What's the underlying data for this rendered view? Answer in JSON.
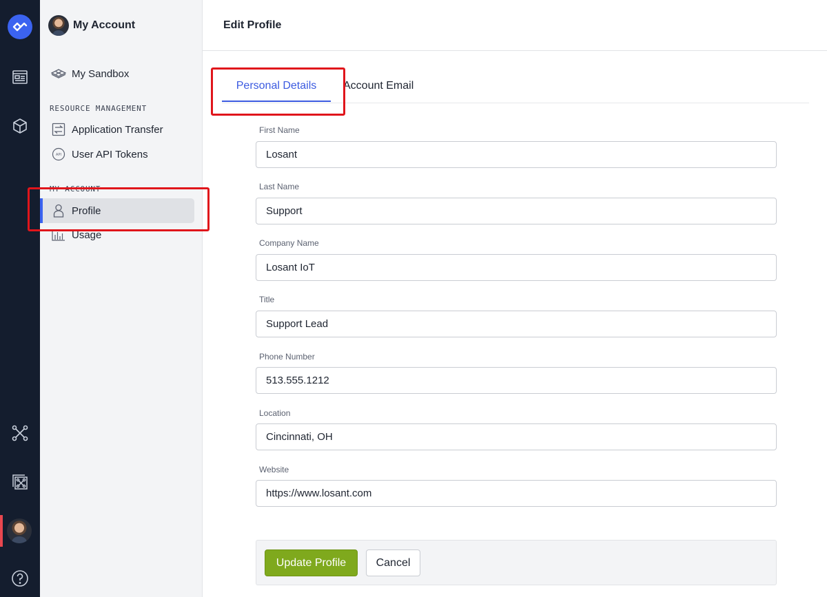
{
  "rail": {
    "items": [
      {
        "name": "logo",
        "icon": "losant-logo-icon"
      },
      {
        "name": "dashboards",
        "icon": "dashboard-icon"
      },
      {
        "name": "applications",
        "icon": "cube-icon"
      },
      {
        "name": "edge",
        "icon": "network-icon"
      },
      {
        "name": "experience",
        "icon": "nodes-grid-icon"
      },
      {
        "name": "account",
        "icon": "avatar"
      },
      {
        "name": "help",
        "icon": "help-icon"
      }
    ]
  },
  "sidebar": {
    "title": "My Account",
    "sandbox_label": "My Sandbox",
    "resource_section": "RESOURCE MANAGEMENT",
    "resource_items": [
      {
        "label": "Application Transfer",
        "icon": "transfer-icon"
      },
      {
        "label": "User API Tokens",
        "icon": "api-token-icon"
      }
    ],
    "account_section": "MY ACCOUNT",
    "account_items": [
      {
        "label": "Profile",
        "icon": "user-icon",
        "active": true
      },
      {
        "label": "Usage",
        "icon": "bar-chart-icon",
        "active": false
      }
    ]
  },
  "header": {
    "title": "Edit Profile"
  },
  "tabs": [
    {
      "label": "Personal Details",
      "active": true
    },
    {
      "label": "Account Email",
      "active": false
    }
  ],
  "form": {
    "fields": [
      {
        "label": "First Name",
        "value": "Losant"
      },
      {
        "label": "Last Name",
        "value": "Support"
      },
      {
        "label": "Company Name",
        "value": "Losant IoT"
      },
      {
        "label": "Title",
        "value": "Support Lead"
      },
      {
        "label": "Phone Number",
        "value": "513.555.1212"
      },
      {
        "label": "Location",
        "value": "Cincinnati, OH"
      },
      {
        "label": "Website",
        "value": "https://www.losant.com"
      }
    ],
    "submit_label": "Update Profile",
    "cancel_label": "Cancel"
  },
  "colors": {
    "accent": "#3b63f0",
    "primary_button": "#7fa91d",
    "highlight": "#e0151b",
    "rail_bg": "#141d2e"
  }
}
